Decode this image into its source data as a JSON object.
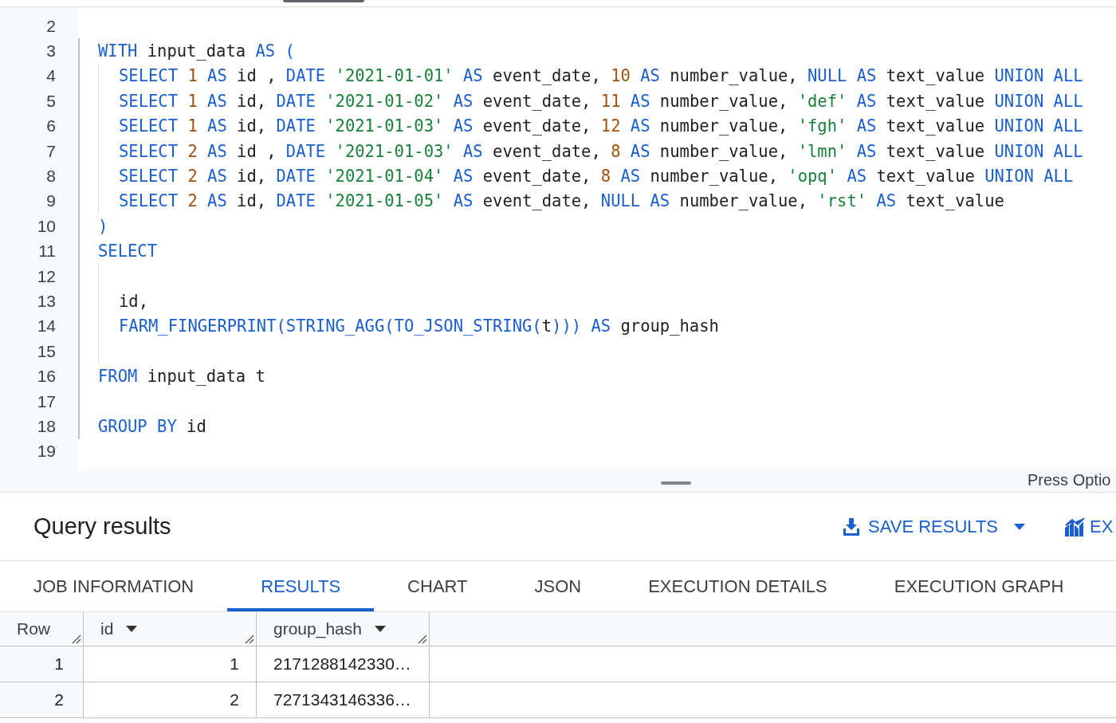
{
  "editor": {
    "lines": [
      {
        "number": "2",
        "block": false,
        "indented": false
      },
      {
        "number": "3",
        "block": true,
        "indented": false,
        "tokens": [
          {
            "kind": "keyword",
            "text": "WITH"
          },
          {
            "kind": "plain",
            "text": " input_data "
          },
          {
            "kind": "keyword",
            "text": "AS ("
          }
        ]
      },
      {
        "number": "4",
        "block": true,
        "indented": true,
        "tokens": [
          {
            "kind": "keyword",
            "text": "SELECT "
          },
          {
            "kind": "number",
            "text": "1 "
          },
          {
            "kind": "keyword",
            "text": "AS"
          },
          {
            "kind": "plain",
            "text": " id , "
          },
          {
            "kind": "keyword",
            "text": "DATE "
          },
          {
            "kind": "string",
            "text": "'2021-01-01' "
          },
          {
            "kind": "keyword",
            "text": "AS"
          },
          {
            "kind": "plain",
            "text": " event_date, "
          },
          {
            "kind": "number",
            "text": "10 "
          },
          {
            "kind": "keyword",
            "text": "AS"
          },
          {
            "kind": "plain",
            "text": " number_value, "
          },
          {
            "kind": "keyword",
            "text": "NULL AS"
          },
          {
            "kind": "plain",
            "text": " text_value "
          },
          {
            "kind": "keyword",
            "text": "UNION ALL"
          }
        ]
      },
      {
        "number": "5",
        "block": true,
        "indented": true,
        "tokens": [
          {
            "kind": "keyword",
            "text": "SELECT "
          },
          {
            "kind": "number",
            "text": "1 "
          },
          {
            "kind": "keyword",
            "text": "AS"
          },
          {
            "kind": "plain",
            "text": " id, "
          },
          {
            "kind": "keyword",
            "text": "DATE "
          },
          {
            "kind": "string",
            "text": "'2021-01-02' "
          },
          {
            "kind": "keyword",
            "text": "AS"
          },
          {
            "kind": "plain",
            "text": " event_date, "
          },
          {
            "kind": "number",
            "text": "11 "
          },
          {
            "kind": "keyword",
            "text": "AS"
          },
          {
            "kind": "plain",
            "text": " number_value, "
          },
          {
            "kind": "string",
            "text": "'def' "
          },
          {
            "kind": "keyword",
            "text": "AS"
          },
          {
            "kind": "plain",
            "text": " text_value "
          },
          {
            "kind": "keyword",
            "text": "UNION ALL"
          }
        ]
      },
      {
        "number": "6",
        "block": true,
        "indented": true,
        "tokens": [
          {
            "kind": "keyword",
            "text": "SELECT "
          },
          {
            "kind": "number",
            "text": "1 "
          },
          {
            "kind": "keyword",
            "text": "AS"
          },
          {
            "kind": "plain",
            "text": " id, "
          },
          {
            "kind": "keyword",
            "text": "DATE "
          },
          {
            "kind": "string",
            "text": "'2021-01-03' "
          },
          {
            "kind": "keyword",
            "text": "AS"
          },
          {
            "kind": "plain",
            "text": " event_date, "
          },
          {
            "kind": "number",
            "text": "12 "
          },
          {
            "kind": "keyword",
            "text": "AS"
          },
          {
            "kind": "plain",
            "text": " number_value, "
          },
          {
            "kind": "string",
            "text": "'fgh' "
          },
          {
            "kind": "keyword",
            "text": "AS"
          },
          {
            "kind": "plain",
            "text": " text_value "
          },
          {
            "kind": "keyword",
            "text": "UNION ALL"
          }
        ]
      },
      {
        "number": "7",
        "block": true,
        "indented": true,
        "tokens": [
          {
            "kind": "keyword",
            "text": "SELECT "
          },
          {
            "kind": "number",
            "text": "2 "
          },
          {
            "kind": "keyword",
            "text": "AS"
          },
          {
            "kind": "plain",
            "text": " id , "
          },
          {
            "kind": "keyword",
            "text": "DATE "
          },
          {
            "kind": "string",
            "text": "'2021-01-03' "
          },
          {
            "kind": "keyword",
            "text": "AS"
          },
          {
            "kind": "plain",
            "text": " event_date, "
          },
          {
            "kind": "number",
            "text": "8 "
          },
          {
            "kind": "keyword",
            "text": "AS"
          },
          {
            "kind": "plain",
            "text": " number_value, "
          },
          {
            "kind": "string",
            "text": "'lmn' "
          },
          {
            "kind": "keyword",
            "text": "AS"
          },
          {
            "kind": "plain",
            "text": " text_value "
          },
          {
            "kind": "keyword",
            "text": "UNION ALL"
          }
        ]
      },
      {
        "number": "8",
        "block": true,
        "indented": true,
        "tokens": [
          {
            "kind": "keyword",
            "text": "SELECT "
          },
          {
            "kind": "number",
            "text": "2 "
          },
          {
            "kind": "keyword",
            "text": "AS"
          },
          {
            "kind": "plain",
            "text": " id, "
          },
          {
            "kind": "keyword",
            "text": "DATE "
          },
          {
            "kind": "string",
            "text": "'2021-01-04' "
          },
          {
            "kind": "keyword",
            "text": "AS"
          },
          {
            "kind": "plain",
            "text": " event_date, "
          },
          {
            "kind": "number",
            "text": "8 "
          },
          {
            "kind": "keyword",
            "text": "AS"
          },
          {
            "kind": "plain",
            "text": " number_value, "
          },
          {
            "kind": "string",
            "text": "'opq' "
          },
          {
            "kind": "keyword",
            "text": "AS"
          },
          {
            "kind": "plain",
            "text": " text_value "
          },
          {
            "kind": "keyword",
            "text": "UNION ALL"
          }
        ]
      },
      {
        "number": "9",
        "block": true,
        "indented": true,
        "tokens": [
          {
            "kind": "keyword",
            "text": "SELECT "
          },
          {
            "kind": "number",
            "text": "2 "
          },
          {
            "kind": "keyword",
            "text": "AS"
          },
          {
            "kind": "plain",
            "text": " id, "
          },
          {
            "kind": "keyword",
            "text": "DATE "
          },
          {
            "kind": "string",
            "text": "'2021-01-05' "
          },
          {
            "kind": "keyword",
            "text": "AS"
          },
          {
            "kind": "plain",
            "text": " event_date, "
          },
          {
            "kind": "keyword",
            "text": "NULL AS"
          },
          {
            "kind": "plain",
            "text": " number_value, "
          },
          {
            "kind": "string",
            "text": "'rst' "
          },
          {
            "kind": "keyword",
            "text": "AS"
          },
          {
            "kind": "plain",
            "text": " text_value"
          }
        ]
      },
      {
        "number": "10",
        "block": true,
        "indented": false,
        "tokens": [
          {
            "kind": "keyword",
            "text": ")"
          }
        ]
      },
      {
        "number": "11",
        "block": true,
        "indented": false,
        "tokens": [
          {
            "kind": "keyword",
            "text": "SELECT"
          }
        ]
      },
      {
        "number": "12",
        "block": true,
        "indented": true
      },
      {
        "number": "13",
        "block": true,
        "indented": true,
        "tokens": [
          {
            "kind": "plain",
            "text": "id,"
          }
        ]
      },
      {
        "number": "14",
        "block": true,
        "indented": true,
        "tokens": [
          {
            "kind": "keyword",
            "text": "FARM_FINGERPRINT(STRING_AGG(TO_JSON_STRING("
          },
          {
            "kind": "plain",
            "text": "t"
          },
          {
            "kind": "keyword",
            "text": "))) AS"
          },
          {
            "kind": "plain",
            "text": " group_hash"
          }
        ]
      },
      {
        "number": "15",
        "block": true,
        "indented": true
      },
      {
        "number": "16",
        "block": true,
        "indented": false,
        "tokens": [
          {
            "kind": "keyword",
            "text": "FROM"
          },
          {
            "kind": "plain",
            "text": " input_data t"
          }
        ]
      },
      {
        "number": "17",
        "block": true,
        "indented": false
      },
      {
        "number": "18",
        "block": true,
        "indented": false,
        "tokens": [
          {
            "kind": "keyword",
            "text": "GROUP BY"
          },
          {
            "kind": "plain",
            "text": " id"
          }
        ]
      },
      {
        "number": "19",
        "block": false,
        "indented": false
      }
    ]
  },
  "status_hint": "Press Optio",
  "results": {
    "title": "Query results",
    "save_button": "SAVE RESULTS",
    "explore_button": "EX",
    "tabs": [
      {
        "label": "JOB INFORMATION",
        "selected": false
      },
      {
        "label": "RESULTS",
        "selected": true
      },
      {
        "label": "CHART",
        "selected": false
      },
      {
        "label": "JSON",
        "selected": false
      },
      {
        "label": "EXECUTION DETAILS",
        "selected": false
      },
      {
        "label": "EXECUTION GRAPH",
        "selected": false
      }
    ],
    "table": {
      "columns": [
        {
          "label": "Row",
          "sortable": false
        },
        {
          "label": "id",
          "sortable": true
        },
        {
          "label": "group_hash",
          "sortable": true
        }
      ],
      "rows": [
        [
          "1",
          "1",
          "2171288142330…"
        ],
        [
          "2",
          "2",
          "7271343146336…"
        ]
      ]
    }
  }
}
